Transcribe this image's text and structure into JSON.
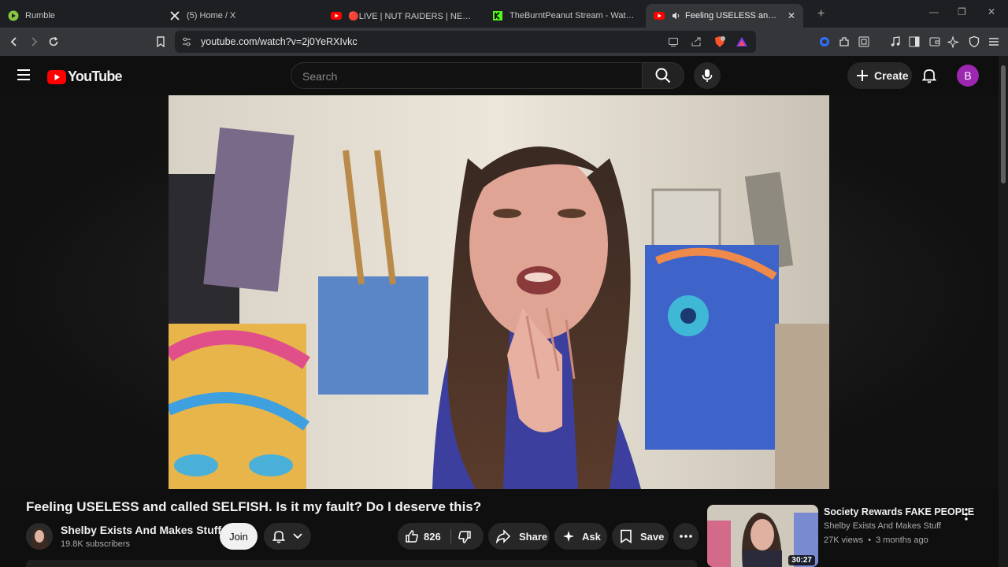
{
  "browser": {
    "tabs": [
      {
        "label": "Rumble",
        "icon": "rumble-icon",
        "active": false
      },
      {
        "label": "(5) Home / X",
        "icon": "x-icon",
        "active": false
      },
      {
        "label": "🔴LIVE | NUT RAIDERS | NEW YEAR",
        "icon": "youtube-icon",
        "active": false
      },
      {
        "label": "TheBurntPeanut Stream - Watch Live",
        "icon": "kick-icon",
        "active": false
      },
      {
        "label": "Feeling USELESS and called SE",
        "icon": "youtube-icon",
        "active": true
      }
    ],
    "new_tab_label": "+",
    "url": "youtube.com/watch?v=2j0YeRXIvkc"
  },
  "youtube": {
    "logo_text": "YouTube",
    "search_placeholder": "Search",
    "create_label": "Create",
    "avatar_letter": "B"
  },
  "video": {
    "title": "Feeling USELESS and called SELFISH. Is it my fault? Do I deserve this?",
    "channel_name": "Shelby Exists And Makes Stuff",
    "subscribers": "19.8K subscribers",
    "join_label": "Join",
    "like_count": "826",
    "share_label": "Share",
    "ask_label": "Ask",
    "save_label": "Save"
  },
  "recommendation": {
    "title": "Society Rewards FAKE PEOPLE",
    "channel": "Shelby Exists And Makes Stuff",
    "views": "27K views",
    "age": "3 months ago",
    "separator": "•",
    "duration": "30:27"
  },
  "colors": {
    "youtube_red": "#ff0000",
    "avatar_purple": "#9c27b0",
    "rumble_green": "#85c742",
    "kick_green": "#53fc18"
  }
}
